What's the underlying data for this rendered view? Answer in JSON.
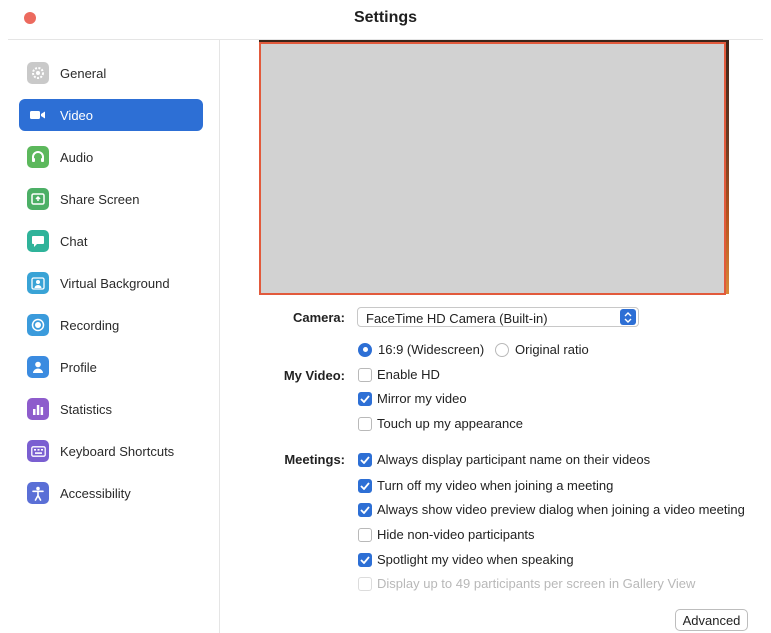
{
  "window": {
    "title": "Settings"
  },
  "sidebar": {
    "items": [
      {
        "label": "General",
        "icon": "gear-icon",
        "color": "#c9c9c9"
      },
      {
        "label": "Video",
        "icon": "video-camera-icon",
        "color": "#2d6fd5",
        "active": true
      },
      {
        "label": "Audio",
        "icon": "headphones-icon",
        "color": "#5cb85c"
      },
      {
        "label": "Share Screen",
        "icon": "share-screen-icon",
        "color": "#4caf66"
      },
      {
        "label": "Chat",
        "icon": "chat-bubble-icon",
        "color": "#2fb39a"
      },
      {
        "label": "Virtual Background",
        "icon": "person-background-icon",
        "color": "#39a3d6"
      },
      {
        "label": "Recording",
        "icon": "record-icon",
        "color": "#3b9bdc"
      },
      {
        "label": "Profile",
        "icon": "person-icon",
        "color": "#3b8be0"
      },
      {
        "label": "Statistics",
        "icon": "bar-chart-icon",
        "color": "#8e5ccc"
      },
      {
        "label": "Keyboard Shortcuts",
        "icon": "keyboard-icon",
        "color": "#7a5fd1"
      },
      {
        "label": "Accessibility",
        "icon": "accessibility-icon",
        "color": "#5a6fd6"
      }
    ]
  },
  "camera": {
    "label": "Camera:",
    "selected": "FaceTime HD Camera (Built-in)"
  },
  "aspect": {
    "widescreen": "16:9 (Widescreen)",
    "original": "Original ratio"
  },
  "my_video": {
    "label": "My Video:",
    "enable_hd": "Enable HD",
    "mirror": "Mirror my video",
    "touch_up": "Touch up my appearance"
  },
  "meetings": {
    "label": "Meetings:",
    "display_names": "Always display participant name on their videos",
    "turn_off": "Turn off my video when joining a meeting",
    "preview_dialog": "Always show video preview dialog when joining a video meeting",
    "hide_nonvideo": "Hide non-video participants",
    "spotlight": "Spotlight my video when speaking",
    "gallery_49": "Display up to 49 participants per screen in Gallery View"
  },
  "advanced_button": "Advanced"
}
